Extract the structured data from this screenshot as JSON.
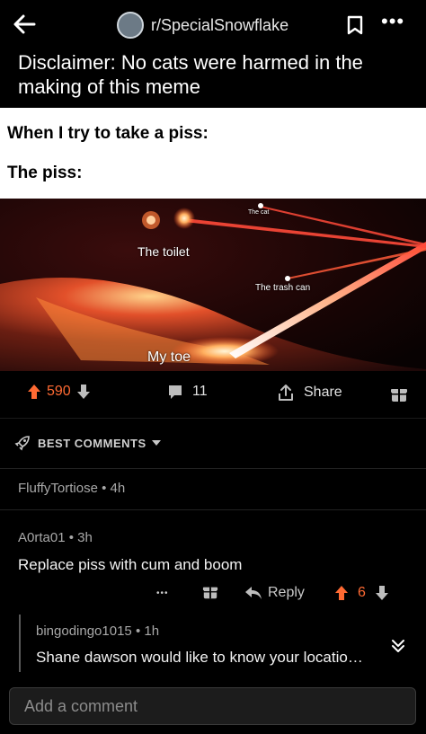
{
  "header": {
    "subreddit": "r/SpecialSnowflake",
    "back_icon": "arrow-left-icon",
    "save_icon": "bookmark-icon",
    "more_icon": "more-horizontal-icon",
    "more_glyph": "•••"
  },
  "post": {
    "title": "Disclaimer: No cats were harmed in the making of this meme"
  },
  "meme": {
    "line1": "When I try to take a piss:",
    "line2": "The piss:",
    "labels": {
      "toilet": "The toilet",
      "cat": "The cat",
      "trash": "The trash can",
      "toe": "My toe"
    }
  },
  "actions": {
    "upvotes": "590",
    "comments": "11",
    "share": "Share",
    "accent": "#ff6a33"
  },
  "sort": {
    "label": "BEST COMMENTS"
  },
  "comments": [
    {
      "author": "FluffyTortiose",
      "age": "4h"
    },
    {
      "author": "A0rta01",
      "age": "3h",
      "body": "Replace piss with cum and boom",
      "more": "•••",
      "reply": "Reply",
      "votes": "6"
    },
    {
      "author": "bingodingo1015",
      "age": "1h",
      "body": "Shane dawson would like to know your locatio…"
    }
  ],
  "composer": {
    "placeholder": "Add a comment"
  }
}
